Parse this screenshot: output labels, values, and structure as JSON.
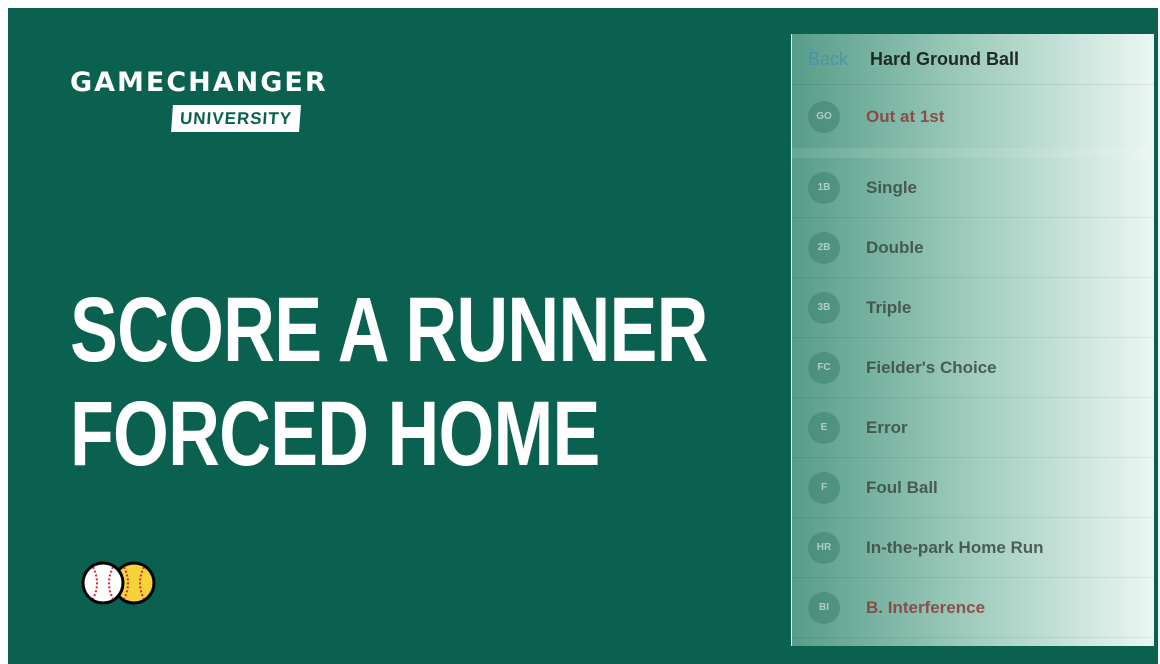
{
  "brand": {
    "name": "GAMECHANGER",
    "sub": "UNIVERSITY"
  },
  "headline": {
    "line1": "SCORE A RUNNER",
    "line2": "FORCED HOME"
  },
  "panel": {
    "back_label": "Back",
    "title": "Hard Ground Ball",
    "items": [
      {
        "icon": "GO",
        "label": "Out at 1st",
        "tone": "red"
      },
      {
        "icon": "1B",
        "label": "Single",
        "tone": "normal"
      },
      {
        "icon": "2B",
        "label": "Double",
        "tone": "normal"
      },
      {
        "icon": "3B",
        "label": "Triple",
        "tone": "normal"
      },
      {
        "icon": "FC",
        "label": "Fielder's Choice",
        "tone": "normal"
      },
      {
        "icon": "E",
        "label": "Error",
        "tone": "normal"
      },
      {
        "icon": "F",
        "label": "Foul Ball",
        "tone": "normal"
      },
      {
        "icon": "HR",
        "label": "In-the-park Home Run",
        "tone": "normal"
      },
      {
        "icon": "BI",
        "label": "B. Interference",
        "tone": "red"
      }
    ]
  },
  "colors": {
    "background": "#0b6150",
    "baseball": "#ffffff",
    "softball": "#f5d33a",
    "stitch": "#d8262b"
  }
}
